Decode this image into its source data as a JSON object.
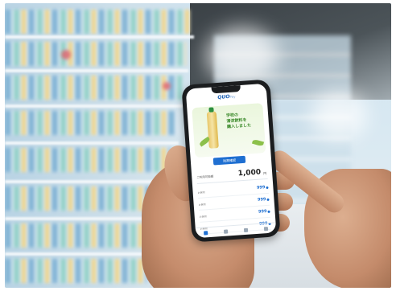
{
  "photo": {
    "subject": "hands-holding-smartphone-in-store-aisle"
  },
  "phone_app": {
    "logo": "QUO",
    "logo_sub": "Pay",
    "banner_text": [
      "学校の",
      "清涼飲料を",
      "購入しました"
    ],
    "cta_label": "残高確認",
    "balance_label": "ご利用可能額",
    "balance_value": "1,000",
    "balance_unit": "円",
    "history": [
      {
        "label": "お買物",
        "amount": "999"
      },
      {
        "label": "お買物",
        "amount": "999"
      },
      {
        "label": "お買物",
        "amount": "999"
      },
      {
        "label": "お買物",
        "amount": "999"
      }
    ],
    "tabs": [
      "home",
      "history",
      "pay",
      "settings"
    ],
    "active_tab": 0
  },
  "colors": {
    "accent": "#1f6fd1",
    "banner_green": "#3b8a2a"
  }
}
